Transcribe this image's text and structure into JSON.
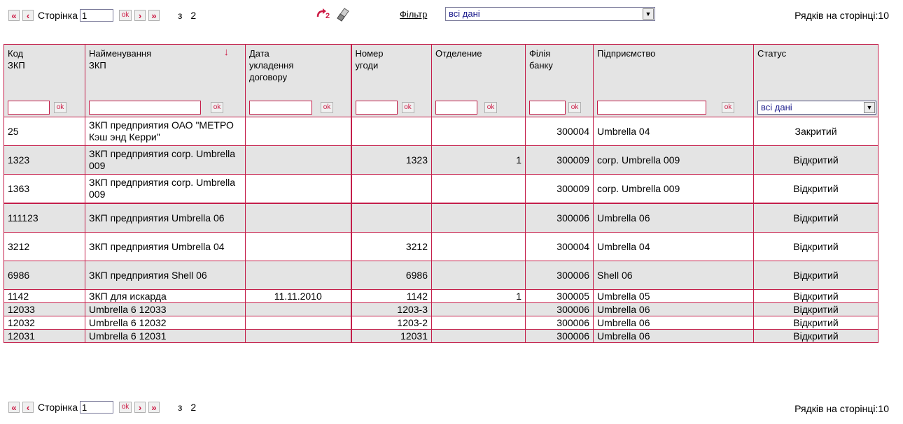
{
  "pager": {
    "first_label": "«",
    "prev_label": "‹",
    "page_label": "Сторінка",
    "page_value": "1",
    "ok_label": "ok",
    "next_label": "›",
    "last_label": "»",
    "of_label": "з",
    "total_pages": "2"
  },
  "tools": {
    "refresh_icon": "refresh-icon",
    "clear_icon": "eraser-icon"
  },
  "filter": {
    "label": "Фільтр",
    "value": "всі дані"
  },
  "rows_per_page": "Рядків на сторінці:10",
  "table": {
    "headers": [
      "Код\nЗКП",
      "Найменування\nЗКП",
      "Дата\nукладення\nдоговору",
      "Номер\nугоди",
      "Отделение",
      "Філія\nбанку",
      "Підприємство",
      "Статус"
    ],
    "filter_ok": "ok",
    "status_filter": "всі дані",
    "rows": [
      [
        "25",
        "ЗКП предприятия ОАО \"МЕТРО Кэш энд Керри\"",
        "",
        "",
        "",
        "300004",
        "Umbrella 04",
        "Закритий"
      ],
      [
        "1323",
        "ЗКП предприятия corp. Umbrella 009",
        "",
        "1323",
        "1",
        "300009",
        "corp. Umbrella 009",
        "Відкритий"
      ],
      [
        "1363",
        "ЗКП предприятия corp. Umbrella 009",
        "",
        "",
        "",
        "300009",
        "corp. Umbrella 009",
        "Відкритий"
      ],
      [
        "111123",
        "ЗКП предприятия Umbrella 06",
        "",
        "",
        "",
        "300006",
        "Umbrella 06",
        "Відкритий"
      ],
      [
        "3212",
        "ЗКП предприятия Umbrella 04",
        "",
        "3212",
        "",
        "300004",
        "Umbrella 04",
        "Відкритий"
      ],
      [
        "6986",
        "ЗКП предприятия Shell 06",
        "",
        "6986",
        "",
        "300006",
        "Shell 06",
        "Відкритий"
      ],
      [
        "1142",
        "ЗКП для искарда",
        "11.11.2010",
        "1142",
        "1",
        "300005",
        "Umbrella 05",
        "Відкритий"
      ],
      [
        "12033",
        "Umbrella 6 12033",
        "",
        "1203-3",
        "",
        "300006",
        "Umbrella 06",
        "Відкритий"
      ],
      [
        "12032",
        "Umbrella 6 12032",
        "",
        "1203-2",
        "",
        "300006",
        "Umbrella 06",
        "Відкритий"
      ],
      [
        "12031",
        "Umbrella 6 12031",
        "",
        "12031",
        "",
        "300006",
        "Umbrella 06",
        "Відкритий"
      ]
    ]
  },
  "colors": {
    "accent": "#c41e4a",
    "row_alt": "#e4e4e4",
    "link": "#1a1a8c"
  }
}
